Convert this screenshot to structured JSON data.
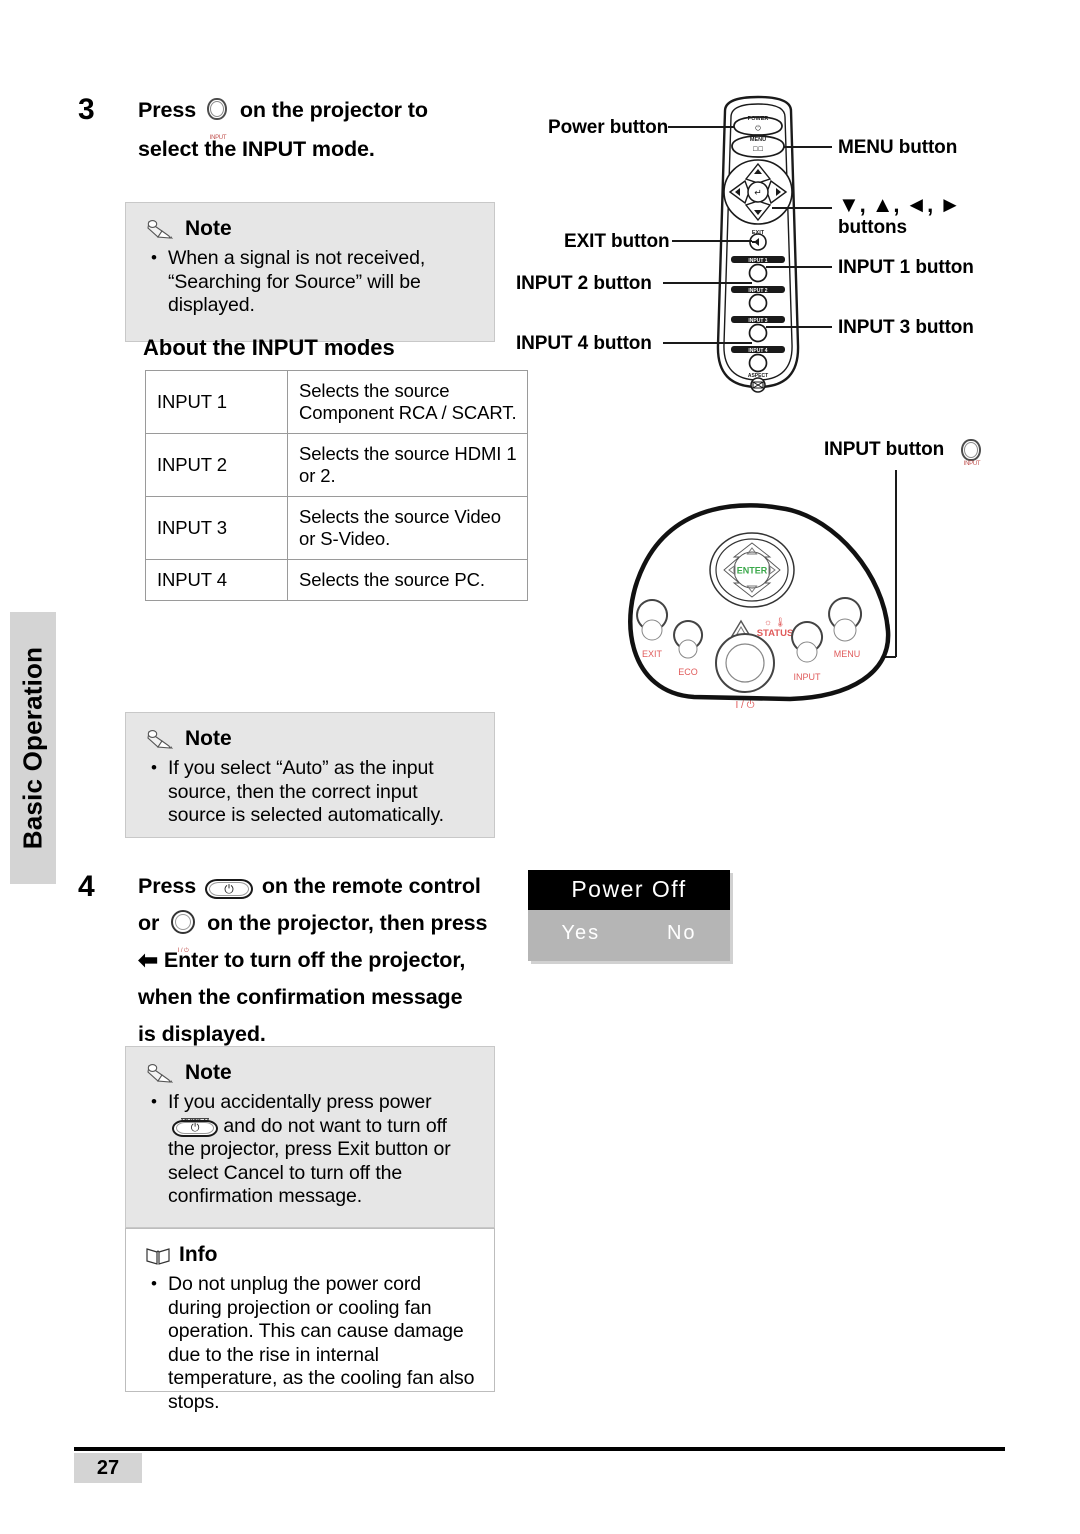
{
  "sidebar": {
    "tab_label": "Basic Operation"
  },
  "steps": [
    {
      "number": "3",
      "line1_before": "Press",
      "line1_after": "on the projector to",
      "line2": "select the INPUT mode.",
      "icon_caption": "INPUT"
    },
    {
      "number": "4",
      "line1_before": "Press",
      "line1_after": "on the remote control",
      "line2_before": "or",
      "line2_after": "on the projector, then press",
      "line3": "Enter to turn off the projector,",
      "line4": "when the confirmation message",
      "line5": "is displayed.",
      "remote_icon_caption": "POWER",
      "projector_icon_caption": "I / ⏻",
      "enter_arrow": "↩"
    }
  ],
  "notes": [
    {
      "title": "Note",
      "items": [
        "When a signal is not received, “Searching for Source” will be displayed."
      ]
    },
    {
      "title": "Note",
      "items": [
        "If you select “Auto” as the input source, then the correct input source is selected automatically."
      ]
    },
    {
      "title": "Note",
      "items": [
        "If you accidentally press power",
        "and do not want to turn off the projector, press Exit button or select Cancel to turn off the confirmation message."
      ],
      "inline_icon_caption": "POWER"
    }
  ],
  "info": {
    "title": "Info",
    "items": [
      "Do not unplug the power cord during projection or cooling fan operation. This can cause damage due to the rise in internal temperature, as the cooling fan also stops."
    ]
  },
  "input_modes": {
    "heading": "About the INPUT modes",
    "rows": [
      {
        "mode": "INPUT 1",
        "description": "Selects the source Component RCA / SCART."
      },
      {
        "mode": "INPUT 2",
        "description": "Selects the source HDMI 1 or 2."
      },
      {
        "mode": "INPUT 3",
        "description": "Selects the source Video or S-Video."
      },
      {
        "mode": "INPUT 4",
        "description": "Selects the source PC."
      }
    ]
  },
  "remote_diagram": {
    "labels": {
      "power": "Power button",
      "menu": "MENU button",
      "exit": "EXIT button",
      "arrows": "▼, ▲, ◄, ►",
      "arrows_second_line": "buttons",
      "input1": "INPUT 1 button",
      "input2": "INPUT 2 button",
      "input3": "INPUT 3 button",
      "input4": "INPUT 4 button"
    },
    "button_captions": {
      "power": "POWER",
      "menu": "MENU",
      "exit": "EXIT",
      "input1": "INPUT 1",
      "input2": "INPUT 2",
      "input3": "INPUT 3",
      "input4": "INPUT 4",
      "aspect": "ASPECT"
    }
  },
  "projector_diagram": {
    "label_input": "INPUT button",
    "icon_caption": "INPUT",
    "panel_captions": {
      "enter": "ENTER",
      "exit": "EXIT",
      "eco": "ECO",
      "status": "STATUS",
      "input": "INPUT",
      "menu": "MENU",
      "power": "I / ⏻"
    }
  },
  "osd": {
    "title": "Power Off",
    "yes": "Yes",
    "no": "No"
  },
  "footer": {
    "page_number": "27"
  },
  "colors": {
    "note_bg": "#e6e6e6",
    "tab_bg": "#d4d4d4",
    "osd_title_bg": "#000000",
    "osd_body_bg": "#b5b5b5",
    "panel_label_red": "#e05b5b",
    "panel_enter_green": "#3aa84a"
  }
}
